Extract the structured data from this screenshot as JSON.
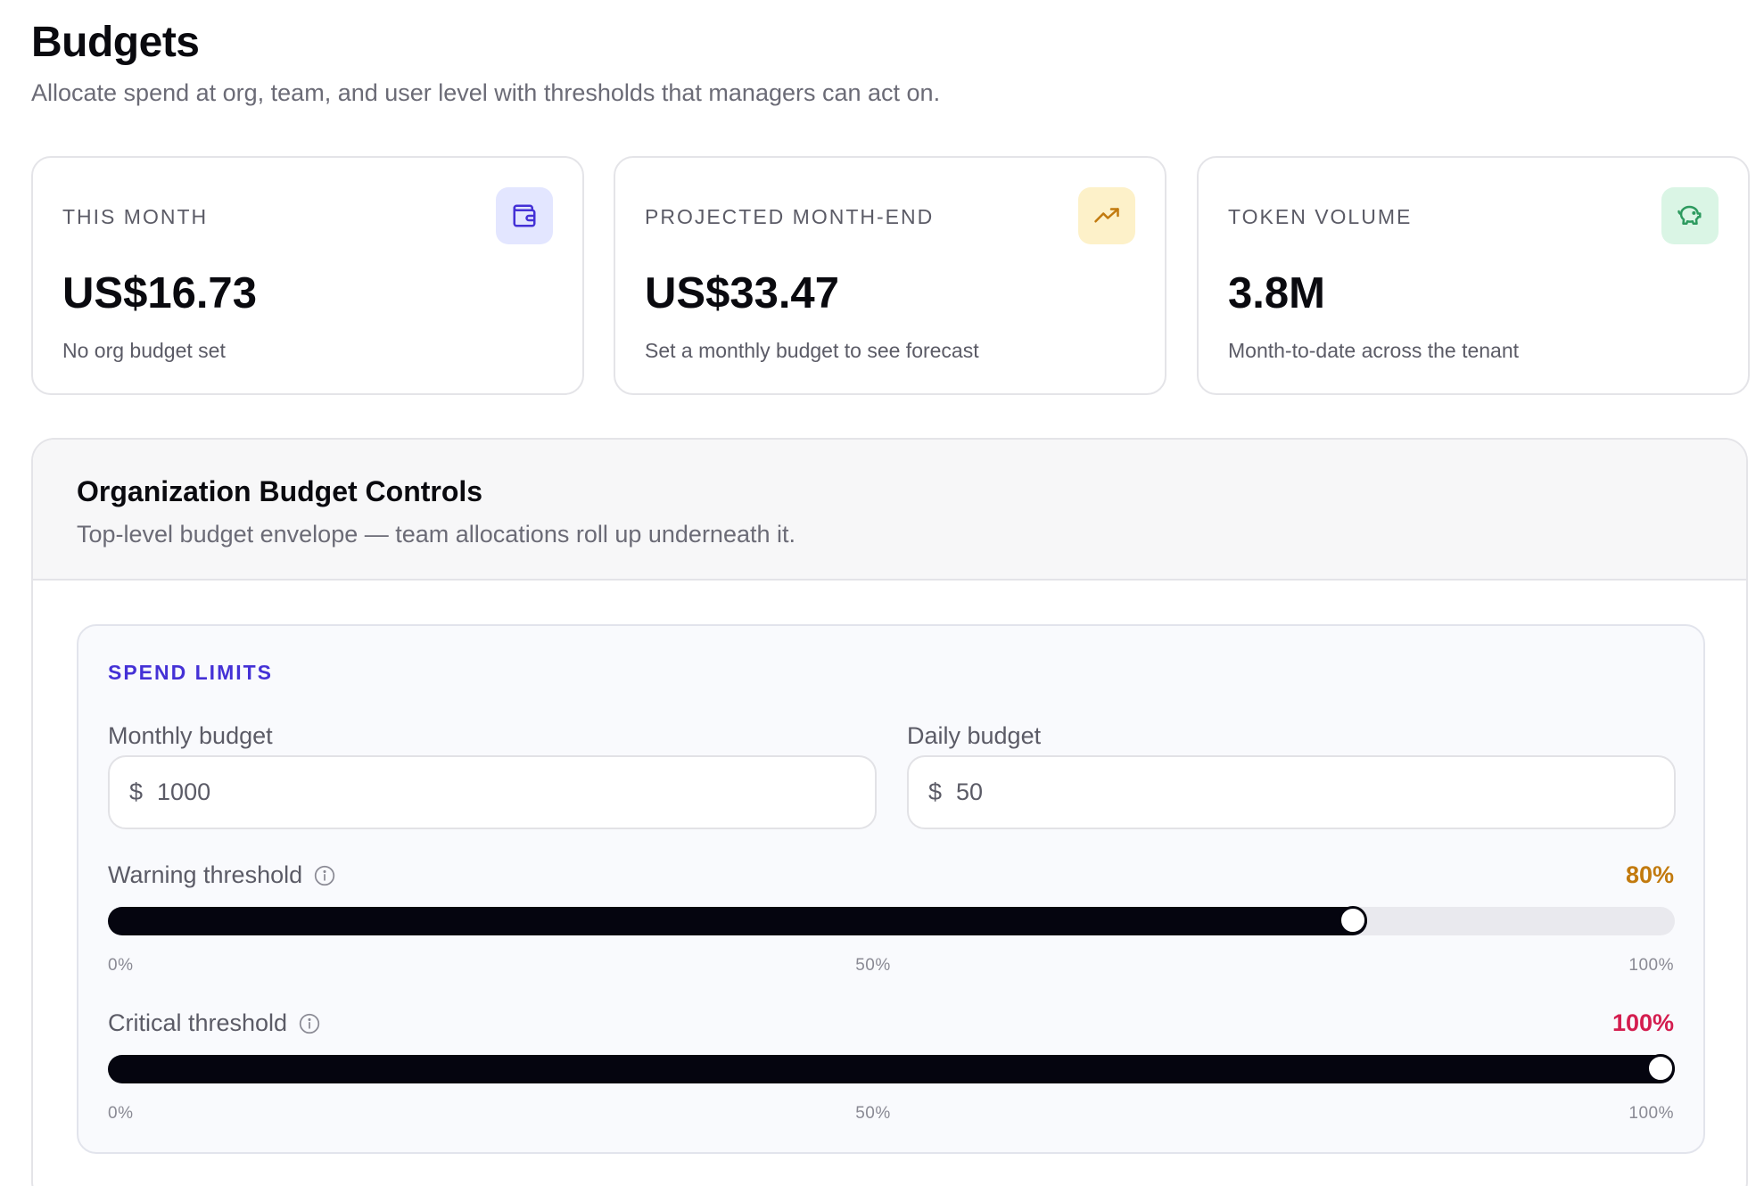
{
  "header": {
    "title": "Budgets",
    "subtitle": "Allocate spend at org, team, and user level with thresholds that managers can act on."
  },
  "stats": [
    {
      "label": "THIS MONTH",
      "value": "US$16.73",
      "note": "No org budget set",
      "icon": "wallet-icon",
      "icon_bg": "#e3e6ff",
      "icon_color": "#4431d6"
    },
    {
      "label": "PROJECTED MONTH-END",
      "value": "US$33.47",
      "note": "Set a monthly budget to see forecast",
      "icon": "trending-up-icon",
      "icon_bg": "#fdf1c9",
      "icon_color": "#c27a0e"
    },
    {
      "label": "TOKEN VOLUME",
      "value": "3.8M",
      "note": "Month-to-date across the tenant",
      "icon": "piggy-bank-icon",
      "icon_bg": "#daf5e5",
      "icon_color": "#2d9a5f"
    }
  ],
  "org_controls": {
    "title": "Organization Budget Controls",
    "description": "Top-level budget envelope — team allocations roll up underneath it.",
    "section_label": "SPEND LIMITS",
    "monthly_budget": {
      "label": "Monthly budget",
      "prefix": "$",
      "value": "1000"
    },
    "daily_budget": {
      "label": "Daily budget",
      "prefix": "$",
      "value": "50"
    },
    "warning": {
      "label": "Warning threshold",
      "value_text": "80%",
      "value": 80,
      "color": "#c27a0e",
      "ticks": [
        "0%",
        "50%",
        "100%"
      ]
    },
    "critical": {
      "label": "Critical threshold",
      "value_text": "100%",
      "value": 100,
      "color": "#d41d4f",
      "ticks": [
        "0%",
        "50%",
        "100%"
      ]
    }
  }
}
